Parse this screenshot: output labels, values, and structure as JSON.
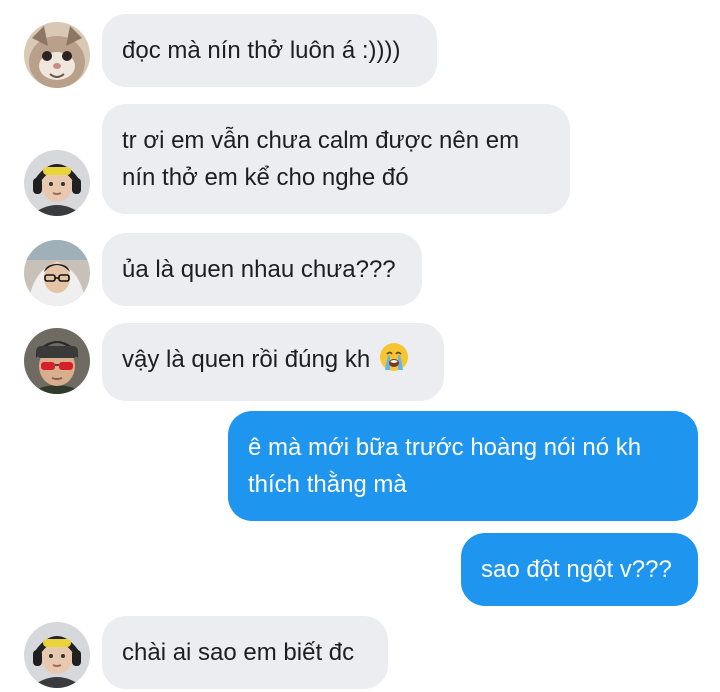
{
  "colors": {
    "incoming_bubble": "#ebedf0",
    "outgoing_bubble": "#1e95ee",
    "incoming_text": "#1c1e21",
    "outgoing_text": "#ffffff"
  },
  "messages": [
    {
      "id": "m1",
      "direction": "incoming",
      "avatar": "cat-avatar",
      "lines": [
        "đọc mà nín thở luôn á :))))"
      ]
    },
    {
      "id": "m2",
      "direction": "incoming",
      "avatar": "headphones-avatar",
      "lines": [
        "tr ơi em vẫn chưa calm được nên em",
        "nín thở em kể cho nghe đó"
      ]
    },
    {
      "id": "m3",
      "direction": "incoming",
      "avatar": "hoodie-glasses-avatar",
      "lines": [
        "ủa là quen nhau chưa???"
      ]
    },
    {
      "id": "m4",
      "direction": "incoming",
      "avatar": "red-sunglasses-avatar",
      "lines": [
        "vậy là quen rồi đúng kh"
      ],
      "emoji": "loudly-crying-face-emoji"
    },
    {
      "id": "m5",
      "direction": "outgoing",
      "lines": [
        "ê mà mới bữa trước hoàng nói nó kh",
        "thích thằng mà"
      ]
    },
    {
      "id": "m6",
      "direction": "outgoing",
      "lines": [
        "sao đột ngột v???"
      ]
    },
    {
      "id": "m7",
      "direction": "incoming",
      "avatar": "headphones-avatar",
      "lines": [
        "chài ai sao em biết đc"
      ]
    }
  ]
}
